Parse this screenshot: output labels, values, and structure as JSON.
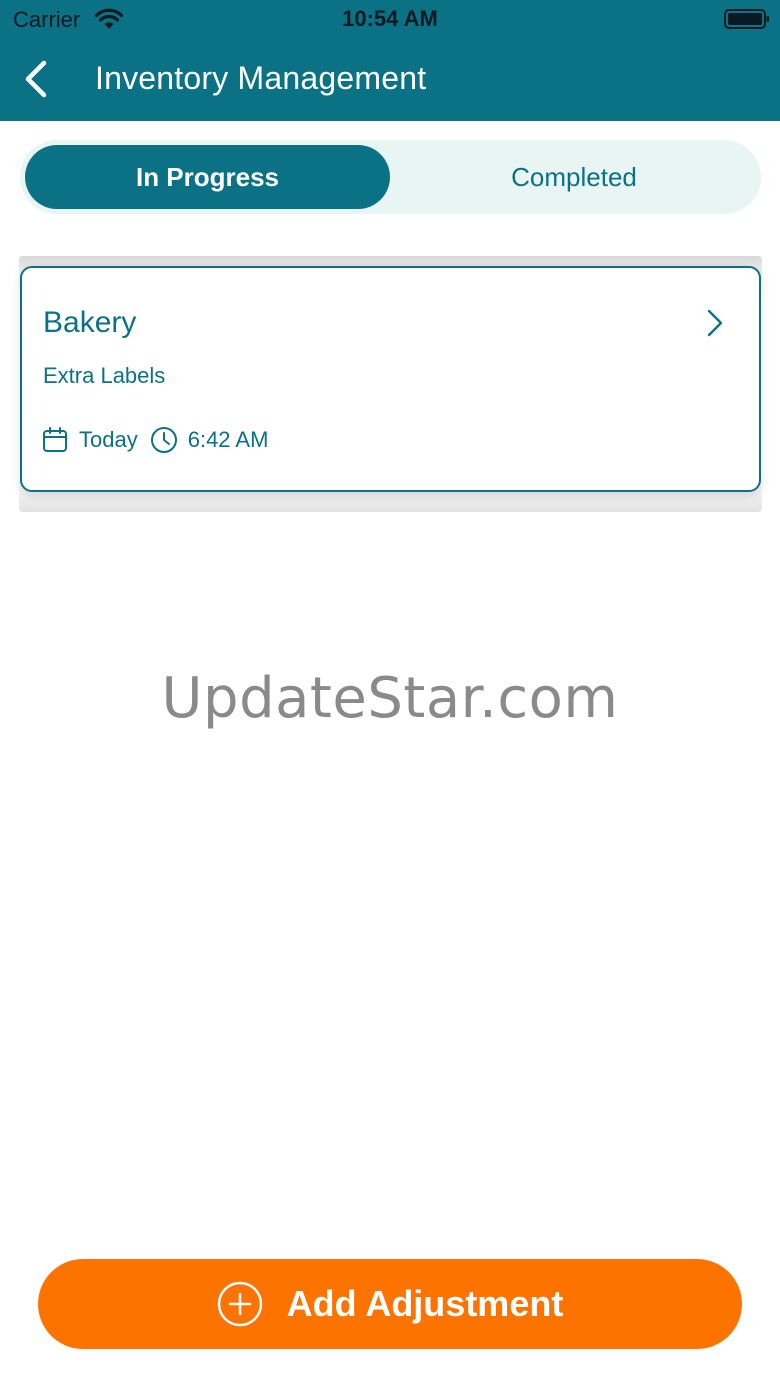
{
  "status_bar": {
    "carrier": "Carrier",
    "time": "10:54 AM",
    "icons": [
      "wifi-icon",
      "battery-icon"
    ]
  },
  "header": {
    "title": "Inventory Management",
    "back_icon": "chevron-left-icon"
  },
  "tabs": [
    {
      "label": "In Progress",
      "active": true
    },
    {
      "label": "Completed",
      "active": false
    }
  ],
  "list": {
    "items": [
      {
        "title": "Bakery",
        "subtitle": "Extra Labels",
        "date": "Today",
        "time": "6:42 AM",
        "icons": [
          "calendar-icon",
          "clock-icon",
          "chevron-right-icon"
        ]
      }
    ]
  },
  "watermark": "UpdateStar.com",
  "actions": {
    "add_label": "Add Adjustment",
    "add_icon": "plus-circle-icon"
  },
  "colors": {
    "primary": "#0b7285",
    "segment_bg": "#e8f5f2",
    "accent": "#fd7300",
    "watermark": "#8a8a8a"
  }
}
